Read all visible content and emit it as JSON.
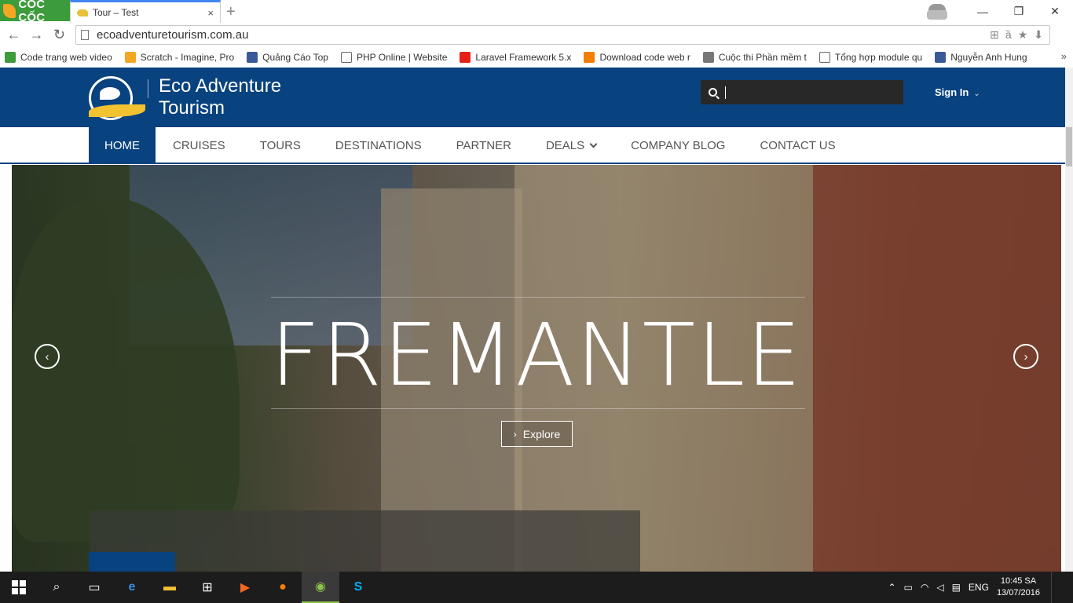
{
  "browser": {
    "brand": "CỐC CỐC",
    "tab_title": "Tour – Test",
    "tab_close": "×",
    "new_tab": "+",
    "url": "ecoadventuretourism.com.au",
    "win_minimize": "—",
    "win_restore": "❐",
    "win_close": "✕"
  },
  "bookmarks": [
    {
      "label": "Code trang web video",
      "color": "#3c9b3a"
    },
    {
      "label": "Scratch - Imagine, Pro",
      "color": "#f5a623"
    },
    {
      "label": "Quảng Cáo Top",
      "color": "#3b5998"
    },
    {
      "label": "PHP Online | Website",
      "color": "#ffffff"
    },
    {
      "label": "Laravel Framework 5.x",
      "color": "#e62117"
    },
    {
      "label": "Download code web r",
      "color": "#f57d00"
    },
    {
      "label": "Cuộc thi Phần mềm t",
      "color": "#777777"
    },
    {
      "label": "Tổng hợp module qu",
      "color": "#ffffff"
    },
    {
      "label": "Nguyễn Anh Hung",
      "color": "#3b5998"
    }
  ],
  "site": {
    "name_line1": "Eco Adventure",
    "name_line2": "Tourism",
    "search_placeholder": "",
    "sign_in": "Sign In",
    "brand_color": "#08427f"
  },
  "nav": {
    "items": [
      {
        "label": "HOME",
        "active": true
      },
      {
        "label": "CRUISES"
      },
      {
        "label": "TOURS"
      },
      {
        "label": "DESTINATIONS"
      },
      {
        "label": "PARTNER"
      },
      {
        "label": "DEALS",
        "dropdown": true
      },
      {
        "label": "COMPANY BLOG"
      },
      {
        "label": "CONTACT US"
      }
    ]
  },
  "hero": {
    "title": "FREMANTLE",
    "explore": "Explore",
    "prev": "‹",
    "next": "›"
  },
  "taskbar": {
    "lang": "ENG",
    "time": "10:45 SA",
    "date": "13/07/2016"
  }
}
